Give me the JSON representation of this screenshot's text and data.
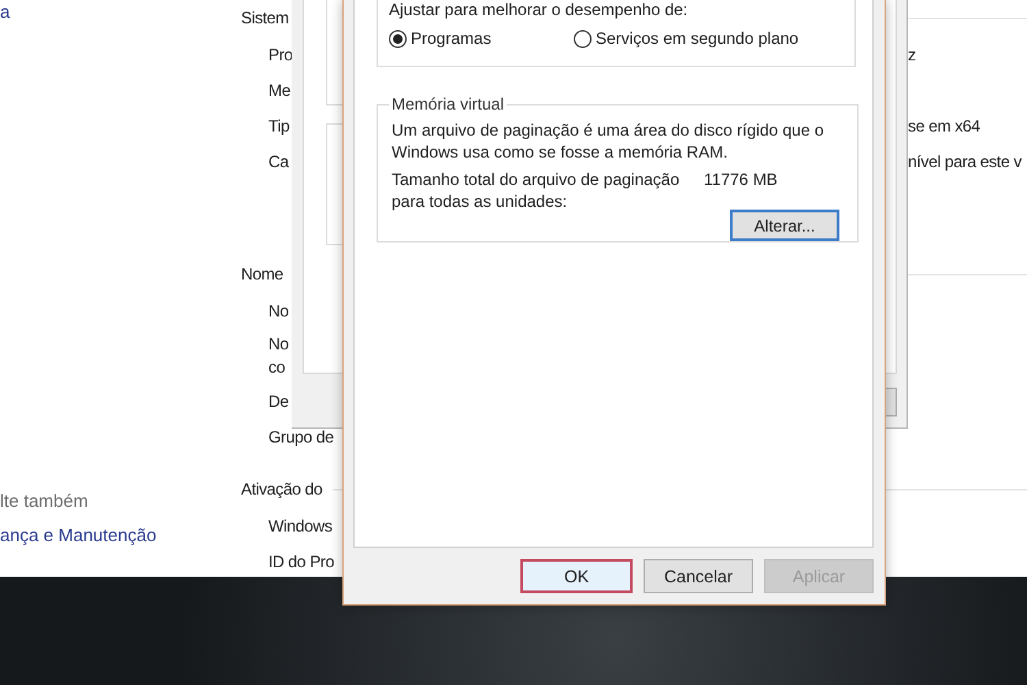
{
  "background_window": {
    "sidebar": {
      "top_link": "a",
      "see_also_heading": "lte também",
      "see_also_links": [
        "ança e Manutenção"
      ]
    },
    "sections": [
      {
        "heading": "Sistem",
        "rows": [
          {
            "label": "Pro",
            "value": "z"
          },
          {
            "label": "Me"
          },
          {
            "label": "Tip",
            "value": "se em x64"
          },
          {
            "label": "Ca",
            "value": "nível para este v"
          }
        ]
      },
      {
        "heading": "Nome",
        "rows": [
          {
            "label": "No"
          },
          {
            "label": "No\nco"
          },
          {
            "label": "De"
          },
          {
            "label": "Grupo de"
          }
        ]
      },
      {
        "heading": "Ativação do",
        "rows": [
          {
            "label": "Windows"
          },
          {
            "label": "ID do Pro"
          }
        ]
      }
    ]
  },
  "performance_dialog": {
    "performance_group": {
      "label": "Ajustar para melhorar o desempenho de:",
      "options": [
        {
          "label": "Programas",
          "selected": true
        },
        {
          "label": "Serviços em segundo plano",
          "selected": false
        }
      ]
    },
    "virtual_memory": {
      "title": "Memória virtual",
      "description": "Um arquivo de paginação é uma área do disco rígido que o Windows usa como se fosse a memória RAM.",
      "size_label": "Tamanho total do arquivo de paginação para todas as unidades:",
      "size_value": "11776 MB",
      "button": "Alterar..."
    },
    "buttons": [
      {
        "label": "OK",
        "default": true,
        "disabled": false
      },
      {
        "label": "Cancelar",
        "default": false,
        "disabled": false
      },
      {
        "label": "Aplicar",
        "default": false,
        "disabled": true
      }
    ]
  }
}
